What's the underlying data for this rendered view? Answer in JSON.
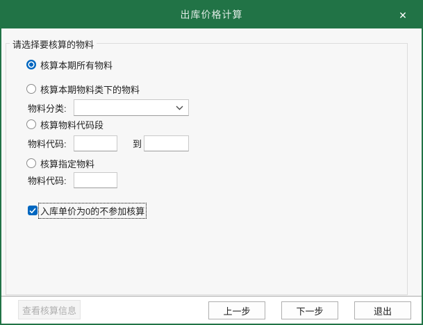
{
  "titlebar": {
    "title": "出库价格计算"
  },
  "icons": {
    "close": "✕"
  },
  "colors": {
    "titlebar_green": "#217346",
    "accent_blue": "#0067c0"
  },
  "form": {
    "group_label": "请选择要核算的物料",
    "radio_all_label": "核算本期所有物料",
    "radio_all_selected": true,
    "radio_category_label": "核算本期物料类下的物料",
    "radio_category_selected": false,
    "category_label": "物料分类:",
    "category_value": "",
    "radio_range_label": "核算物料代码段",
    "radio_range_selected": false,
    "range_label": "物料代码:",
    "range_from_value": "",
    "range_to_text": "到",
    "range_to_value": "",
    "radio_specified_label": "核算指定物料",
    "radio_specified_selected": false,
    "specified_label": "物料代码:",
    "specified_value": "",
    "checkbox_label": "入库单价为0的不参加核算",
    "checkbox_checked": true
  },
  "footer": {
    "view_info": "查看核算信息",
    "view_info_enabled": false,
    "prev": "上一步",
    "next": "下一步",
    "exit": "退出"
  }
}
